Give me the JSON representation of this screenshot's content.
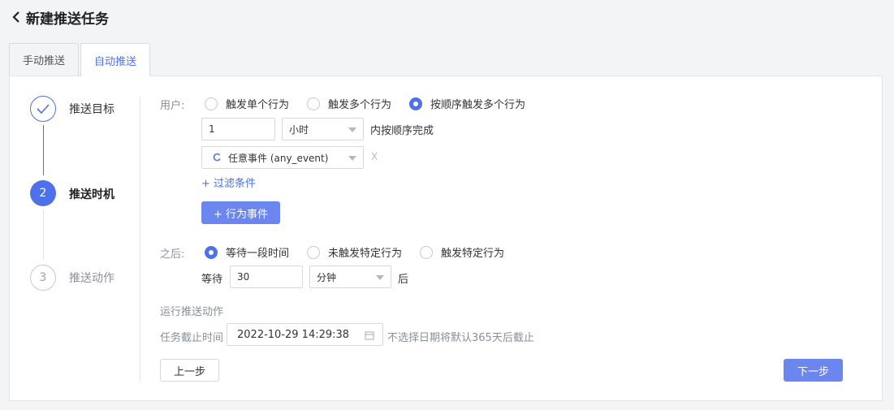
{
  "header": {
    "title": "新建推送任务"
  },
  "tabs": [
    {
      "label": "手动推送"
    },
    {
      "label": "自动推送"
    }
  ],
  "steps": [
    {
      "number": "",
      "label": "推送目标",
      "state": "done"
    },
    {
      "number": "2",
      "label": "推送时机",
      "state": "active"
    },
    {
      "number": "3",
      "label": "推送动作",
      "state": "pending"
    }
  ],
  "user_section": {
    "label": "用户:",
    "radios": [
      {
        "label": "触发单个行为",
        "selected": false
      },
      {
        "label": "触发多个行为",
        "selected": false
      },
      {
        "label": "按顺序触发多个行为",
        "selected": true
      }
    ],
    "duration_value": "1",
    "duration_unit": "小时",
    "duration_suffix": "内按顺序完成",
    "event_select": "任意事件 (any_event)",
    "remove_glyph": "X",
    "filter_link": "+ 过滤条件",
    "add_event_button": "+ 行为事件"
  },
  "after_section": {
    "label": "之后:",
    "radios": [
      {
        "label": "等待一段时间",
        "selected": true
      },
      {
        "label": "未触发特定行为",
        "selected": false
      },
      {
        "label": "触发特定行为",
        "selected": false
      }
    ],
    "wait_label": "等待",
    "wait_value": "30",
    "wait_unit": "分钟",
    "wait_suffix": "后"
  },
  "run_section": {
    "title": "运行推送动作",
    "deadline_label": "任务截止时间",
    "deadline_value": "2022-10-29 14:29:38",
    "deadline_hint": "不选择日期将默认365天后截止"
  },
  "buttons": {
    "prev": "上一步",
    "next": "下一步"
  },
  "colors": {
    "accent": "#4e70e8",
    "button": "#6b86ee"
  }
}
